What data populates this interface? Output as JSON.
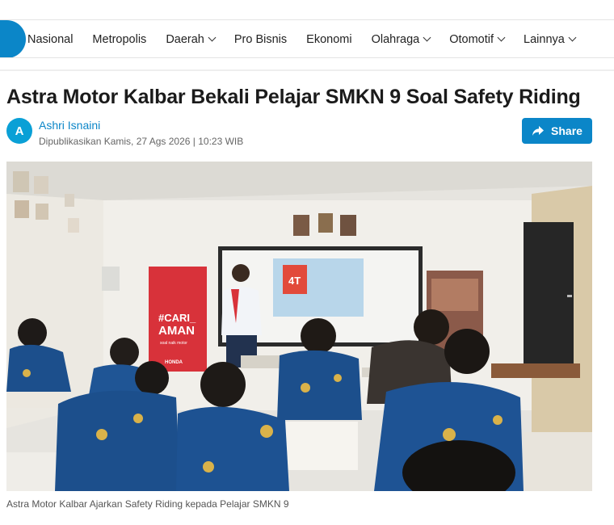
{
  "nav": {
    "items": [
      {
        "label": "Nasional",
        "dropdown": false
      },
      {
        "label": "Metropolis",
        "dropdown": false
      },
      {
        "label": "Daerah",
        "dropdown": true
      },
      {
        "label": "Pro Bisnis",
        "dropdown": false
      },
      {
        "label": "Ekonomi",
        "dropdown": false
      },
      {
        "label": "Olahraga",
        "dropdown": true
      },
      {
        "label": "Otomotif",
        "dropdown": true
      },
      {
        "label": "Lainnya",
        "dropdown": true
      }
    ]
  },
  "article": {
    "title": "Astra Motor Kalbar Bekali Pelajar SMKN 9 Soal Safety Riding",
    "author_initial": "A",
    "author": "Ashri Isnaini",
    "published": "Dipublikasikan Kamis, 27 Ags 2026 | 10:23 WIB",
    "share_label": "Share",
    "caption": "Astra Motor Kalbar Ajarkan Safety Riding kepada Pelajar SMKN 9",
    "photo": {
      "banner_text": "#CARI_\nAMAN",
      "banner_sub": "soal naik motor",
      "banner_brand": "HONDA",
      "screen_text": "4T"
    }
  },
  "colors": {
    "accent": "#0b86c8",
    "uniform": "#1c4f8c",
    "banner": "#d8323a"
  }
}
